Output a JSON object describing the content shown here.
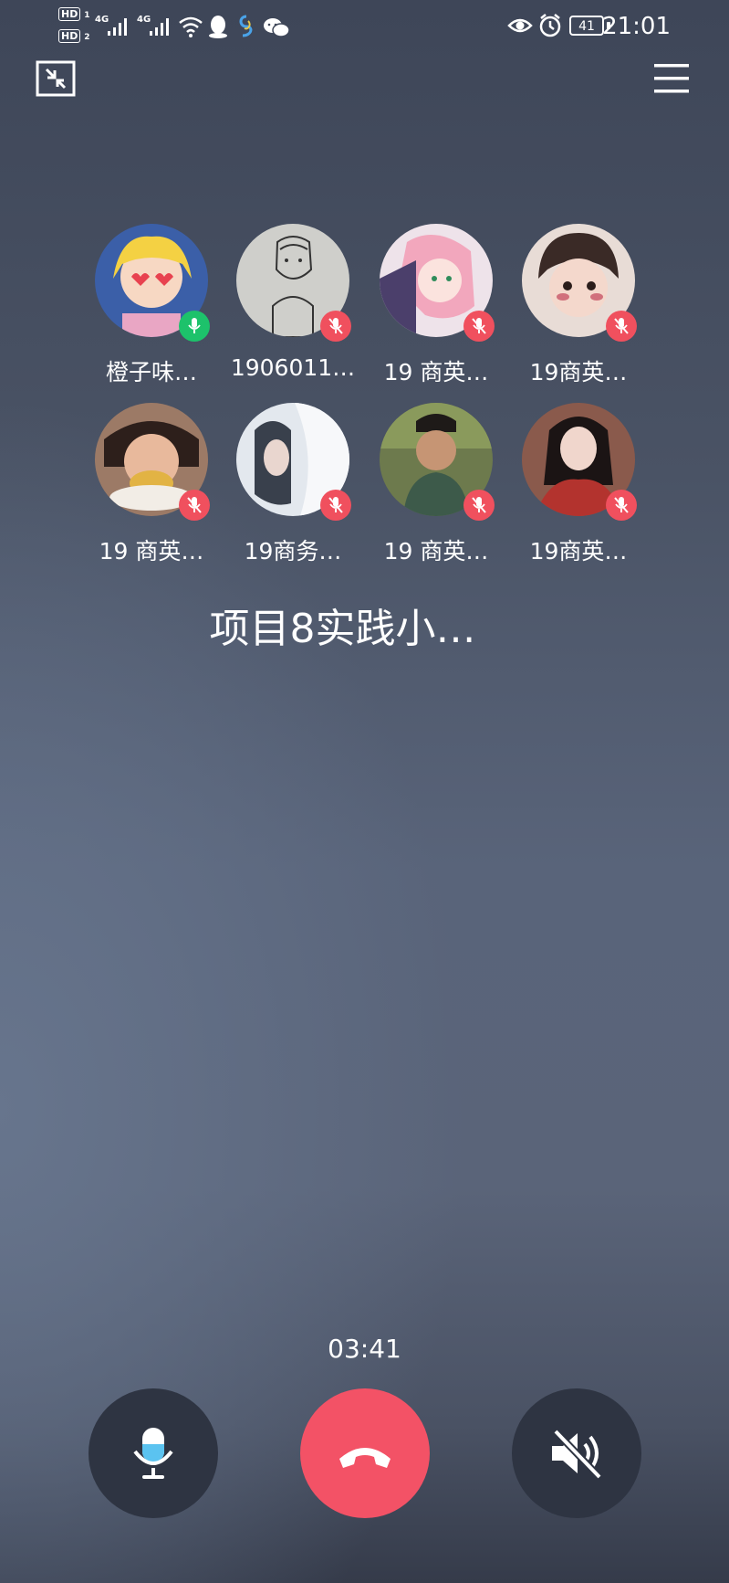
{
  "status_bar": {
    "hd1": "HD",
    "hd1_sub": "1",
    "hd2": "HD",
    "hd2_sub": "2",
    "network1": "4G",
    "network2": "4G",
    "battery": "41",
    "time": "21:01",
    "icons": [
      "signal-icon",
      "signal-icon",
      "wifi-icon",
      "qq-icon",
      "app-icon",
      "wechat-icon",
      "eye-icon",
      "alarm-icon",
      "battery-icon"
    ]
  },
  "top_controls": {
    "minimize_icon": "minimize-icon",
    "menu_icon": "menu-icon"
  },
  "participants": [
    {
      "name": "橙子味…",
      "mic": "on",
      "avatar_color": "#3b5fa8"
    },
    {
      "name": "1906011…",
      "mic": "off",
      "avatar_color": "#c9c9c6"
    },
    {
      "name": "19 商英…",
      "mic": "off",
      "avatar_color": "#e9c2cd"
    },
    {
      "name": "19商英…",
      "mic": "off",
      "avatar_color": "#d9c6c0"
    },
    {
      "name": "19 商英…",
      "mic": "off",
      "avatar_color": "#8d6a55"
    },
    {
      "name": "19商务…",
      "mic": "off",
      "avatar_color": "#dde3ea"
    },
    {
      "name": "19 商英…",
      "mic": "off",
      "avatar_color": "#5b6b45"
    },
    {
      "name": "19商英…",
      "mic": "off",
      "avatar_color": "#7e3a35"
    }
  ],
  "group_name": "项目8实践小…",
  "timer": "03:41",
  "controls": {
    "mic_icon": "microphone-icon",
    "hangup_icon": "hang-up-icon",
    "speaker_icon": "speaker-muted-icon"
  },
  "colors": {
    "mic_on": "#1dc26b",
    "mic_off": "#f0505e",
    "hangup": "#f35266",
    "button_dark": "#2e3442"
  }
}
